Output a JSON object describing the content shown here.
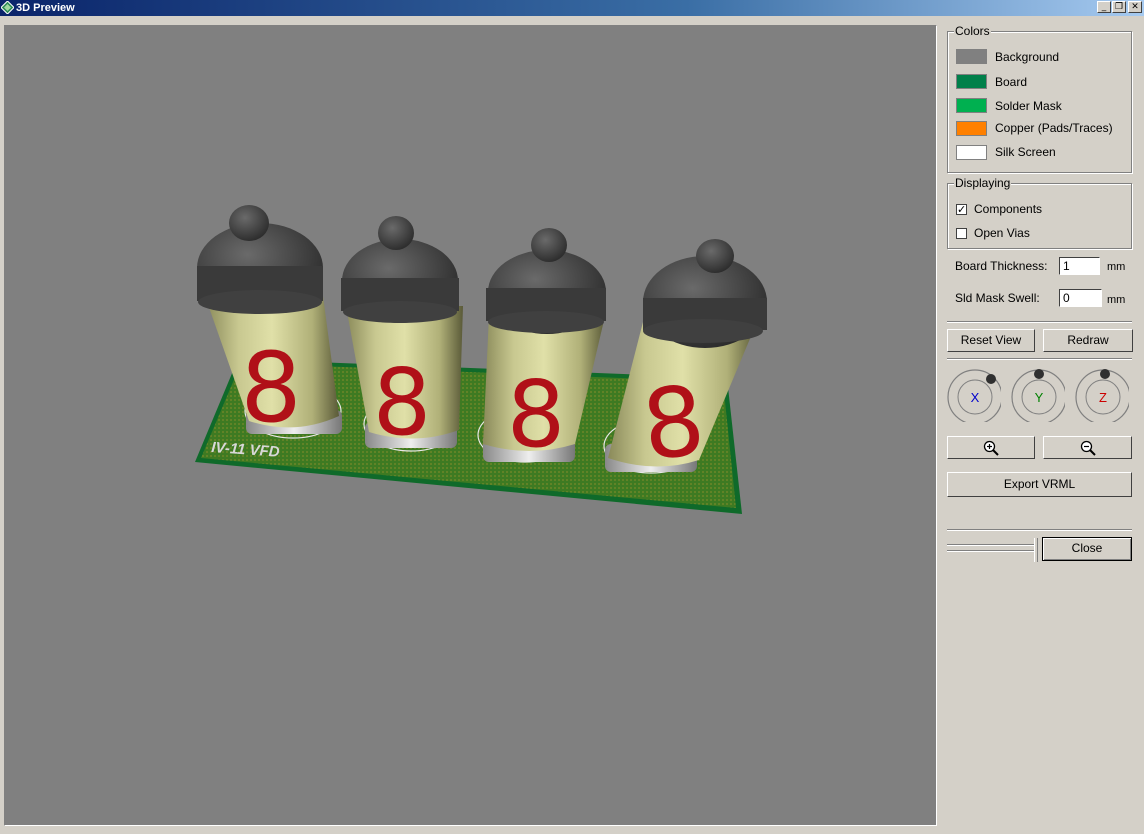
{
  "window": {
    "title": "3D Preview",
    "controls": {
      "minimize": "_",
      "restore": "❐",
      "close": "✕"
    }
  },
  "viewport": {
    "background_color": "#808080",
    "silkscreen_text": "IV-11  VFD",
    "tube_digits": [
      "8",
      "8",
      "8",
      "8"
    ]
  },
  "colors": {
    "title": "Colors",
    "items": [
      {
        "label": "Background",
        "color": "#808080"
      },
      {
        "label": "Board",
        "color": "#00804a"
      },
      {
        "label": "Solder Mask",
        "color": "#00b050"
      },
      {
        "label": "Copper (Pads/Traces)",
        "color": "#ff8000"
      },
      {
        "label": "Silk Screen",
        "color": "#ffffff"
      }
    ]
  },
  "displaying": {
    "title": "Displaying",
    "components": {
      "label": "Components",
      "checked": true,
      "mark": "✓"
    },
    "open_vias": {
      "label": "Open Vias",
      "checked": false
    }
  },
  "board_thickness": {
    "label": "Board Thickness:",
    "value": "1",
    "unit": "mm"
  },
  "sld_mask_swell": {
    "label": "Sld Mask Swell:",
    "value": "0",
    "unit": "mm"
  },
  "buttons": {
    "reset_view": "Reset View",
    "redraw": "Redraw",
    "export_vrml": "Export VRML",
    "close": "Close"
  },
  "rotation": {
    "x": "X",
    "y": "Y",
    "z": "Z"
  }
}
